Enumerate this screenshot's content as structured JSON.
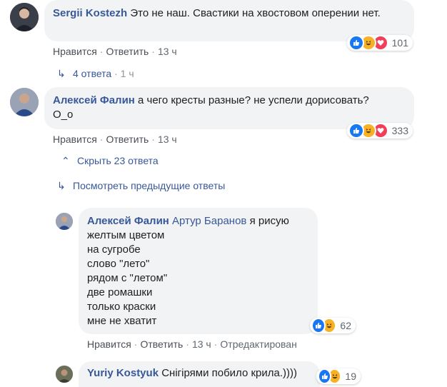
{
  "comments": [
    {
      "author": "Sergii Kostezh",
      "text": "Это не наш. Свастики на хвостовом оперении нет.",
      "actions": {
        "like": "Нравится",
        "reply": "Ответить",
        "time": "13 ч"
      },
      "reactions": {
        "types": [
          "like-icon",
          "haha-icon",
          "love-icon"
        ],
        "count": "101"
      },
      "replies_link": {
        "label": "4 ответа",
        "time": "1 ч"
      }
    },
    {
      "author": "Алексей Фалин",
      "text_line1": "а чего кресты разные? не успели дорисовать?",
      "text_line2": "О_о",
      "actions": {
        "like": "Нравится",
        "reply": "Ответить",
        "time": "13 ч"
      },
      "reactions": {
        "types": [
          "like-icon",
          "haha-icon",
          "love-icon"
        ],
        "count": "333"
      },
      "hide_link": "Скрыть 23 ответа",
      "prev_link": "Посмотреть предыдущие ответы"
    }
  ],
  "replies": [
    {
      "author": "Алексей Фалин",
      "mention": "Артур Баранов",
      "lines": [
        "я рисую",
        "желтым цветом",
        "на сугробе",
        "слово \"лето\"",
        "рядом с \"летом\"",
        "две ромашки",
        "только краски",
        "мне не хватит"
      ],
      "actions": {
        "like": "Нравится",
        "reply": "Ответить",
        "time": "13 ч",
        "edited": "Отредактирован"
      },
      "reactions": {
        "types": [
          "like-icon",
          "haha-icon"
        ],
        "count": "62"
      }
    },
    {
      "author": "Yuriy Kostyuk",
      "text": "Снігірями побило крила.))))",
      "reactions": {
        "types": [
          "like-icon",
          "haha-icon"
        ],
        "count": "19"
      }
    }
  ],
  "colors": {
    "link": "#385898",
    "bubble": "#f2f3f5",
    "like": "#1877f2",
    "haha": "#f7b125",
    "love": "#f33e58"
  }
}
